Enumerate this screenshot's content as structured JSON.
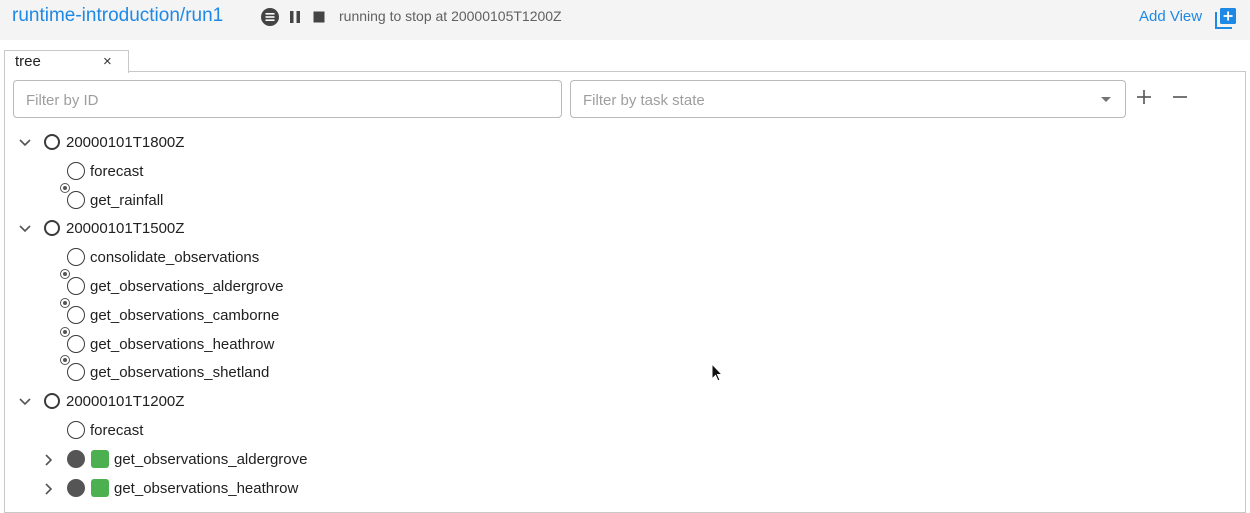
{
  "header": {
    "workflow": "runtime-introduction/run1",
    "status": "running to stop at 20000105T1200Z",
    "add_view": "Add View",
    "icons": [
      "menu-icon",
      "pause-icon",
      "stop-icon",
      "add-box-icon"
    ]
  },
  "tab": {
    "label": "tree",
    "close": "×"
  },
  "filters": {
    "id_placeholder": "Filter by ID",
    "state_placeholder": "Filter by task state"
  },
  "colors": {
    "accent": "#1e88e5",
    "job_running": "#4caf50",
    "task_running": "#555555"
  },
  "tree": {
    "cycle1": {
      "label": "20000101T1800Z",
      "tasks": [
        "forecast",
        "get_rainfall"
      ]
    },
    "cycle2": {
      "label": "20000101T1500Z",
      "tasks": [
        "consolidate_observations",
        "get_observations_aldergrove",
        "get_observations_camborne",
        "get_observations_heathrow",
        "get_observations_shetland"
      ]
    },
    "cycle3": {
      "label": "20000101T1200Z",
      "tasks": [
        "forecast",
        "get_observations_aldergrove",
        "get_observations_heathrow"
      ]
    }
  }
}
